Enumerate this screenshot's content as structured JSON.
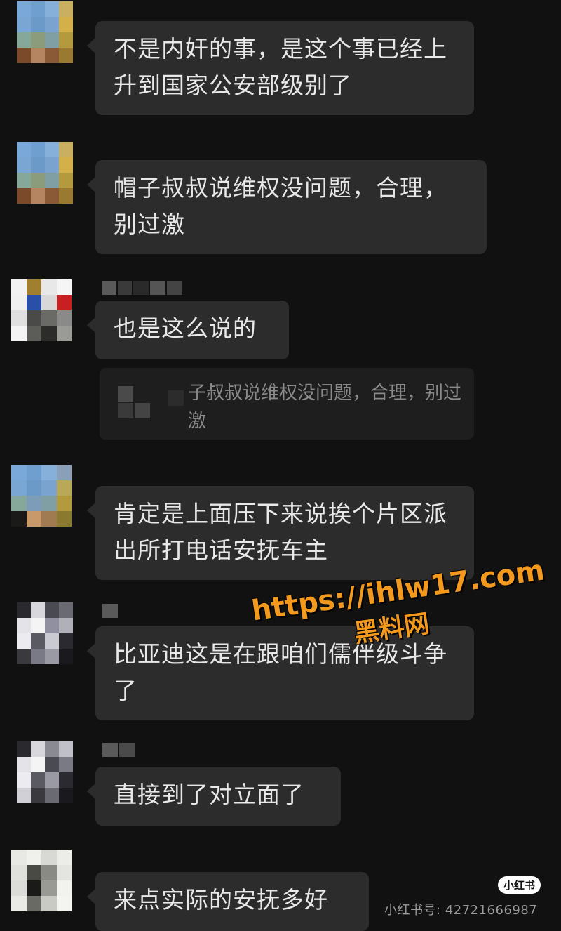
{
  "messages": [
    {
      "text": "不是内奸的事，是这个事已经上升到国家公安部级别了"
    },
    {
      "text": "帽子叔叔说维权没问题，合理，别过激"
    },
    {
      "text": "也是这么说的"
    },
    {
      "text": "肯定是上面压下来说挨个片区派出所打电话安抚车主"
    },
    {
      "text": "比亚迪这是在跟咱们儒伴级斗争了"
    },
    {
      "text": "直接到了对立面了"
    },
    {
      "text": "来点实际的安抚多好"
    }
  ],
  "quote": {
    "text": "子叔叔说维权没问题，合理，别过激"
  },
  "watermark": {
    "url": "https://ihlw17.com",
    "site_name": "黑料网"
  },
  "footer": {
    "logo_text": "小红书",
    "user_id": "小红书号: 42721666987"
  }
}
